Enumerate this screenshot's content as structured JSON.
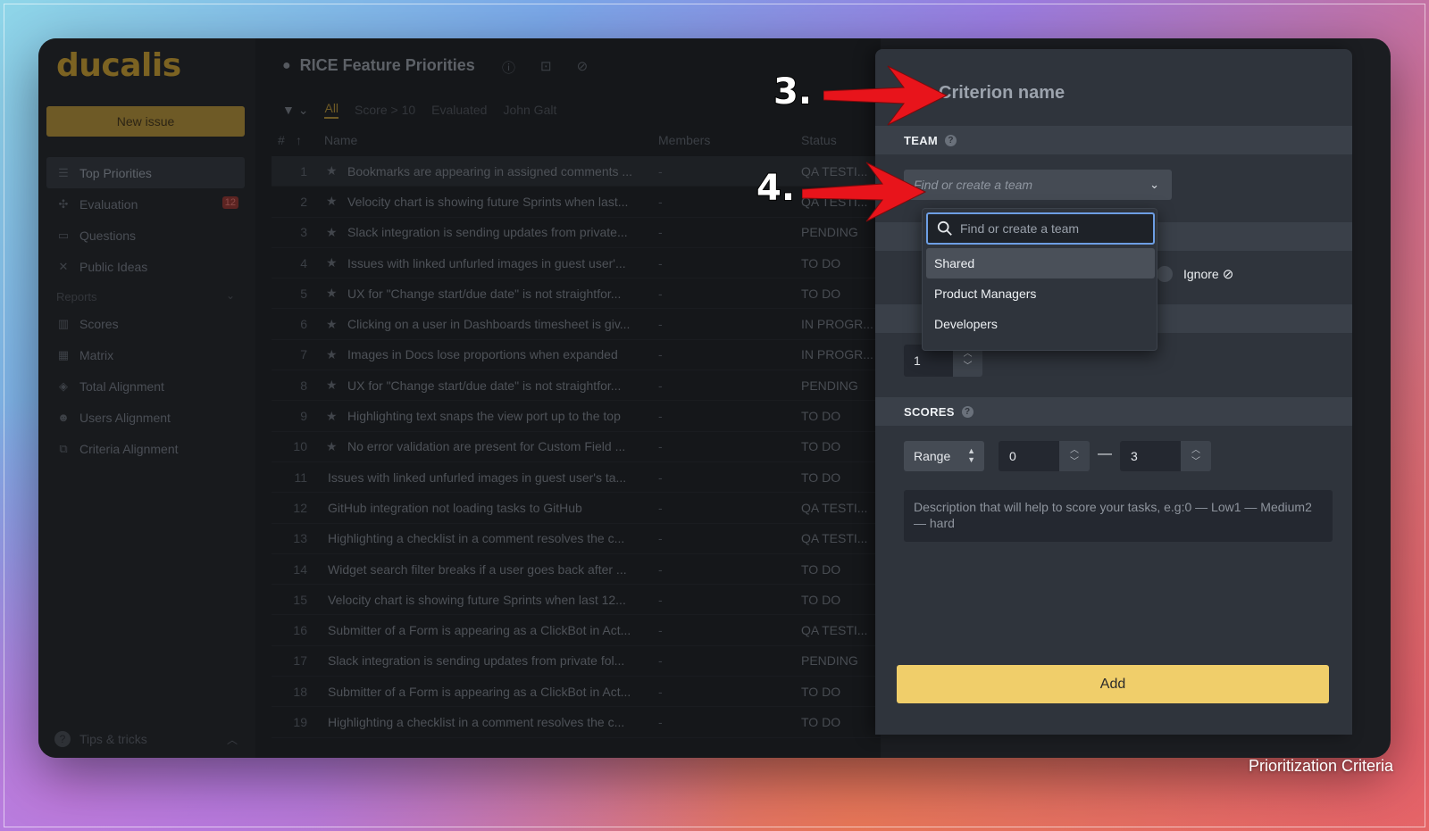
{
  "app": {
    "logo": "ducalis",
    "new_issue_label": "New issue",
    "badge_evaluation": "12",
    "tips_label": "Tips & tricks"
  },
  "sidebar": {
    "items": [
      {
        "label": "Top Priorities",
        "icon": "list-icon"
      },
      {
        "label": "Evaluation",
        "icon": "evaluation-icon"
      },
      {
        "label": "Questions",
        "icon": "questions-icon"
      },
      {
        "label": "Public Ideas",
        "icon": "public-ideas-icon"
      }
    ],
    "reports_label": "Reports",
    "report_items": [
      {
        "label": "Scores",
        "icon": "scores-icon"
      },
      {
        "label": "Matrix",
        "icon": "matrix-icon"
      },
      {
        "label": "Total Alignment",
        "icon": "layers-icon"
      },
      {
        "label": "Users Alignment",
        "icon": "users-icon"
      },
      {
        "label": "Criteria Alignment",
        "icon": "criteria-icon"
      }
    ]
  },
  "board": {
    "title": "RICE Feature Priorities",
    "filters": [
      "All",
      "Score > 10",
      "Evaluated",
      "John Galt"
    ],
    "columns": {
      "num": "#",
      "name": "Name",
      "members": "Members",
      "status": "Status"
    },
    "rows": [
      {
        "num": "1",
        "starred": true,
        "name": "Bookmarks are appearing in assigned comments ...",
        "members": "-",
        "status": "QA TESTI..."
      },
      {
        "num": "2",
        "starred": true,
        "name": "Velocity chart is showing future Sprints when last...",
        "members": "-",
        "status": "QA TESTI..."
      },
      {
        "num": "3",
        "starred": true,
        "name": "Slack integration is sending updates from private...",
        "members": "-",
        "status": "PENDING"
      },
      {
        "num": "4",
        "starred": true,
        "name": "Issues with linked unfurled images in guest user'...",
        "members": "-",
        "status": "TO DO"
      },
      {
        "num": "5",
        "starred": true,
        "name": "UX for \"Change start/due date\" is not straightfor...",
        "members": "-",
        "status": "TO DO"
      },
      {
        "num": "6",
        "starred": true,
        "name": "Clicking on a user in Dashboards timesheet is giv...",
        "members": "-",
        "status": "IN PROGR..."
      },
      {
        "num": "7",
        "starred": true,
        "name": "Images in Docs lose proportions when expanded",
        "members": "-",
        "status": "IN PROGR..."
      },
      {
        "num": "8",
        "starred": true,
        "name": "UX for \"Change start/due date\" is not straightfor...",
        "members": "-",
        "status": "PENDING"
      },
      {
        "num": "9",
        "starred": true,
        "name": "Highlighting text snaps the view port up to the top",
        "members": "-",
        "status": "TO DO"
      },
      {
        "num": "10",
        "starred": true,
        "name": "No error validation are present for Custom Field ...",
        "members": "-",
        "status": "TO DO"
      },
      {
        "num": "11",
        "starred": false,
        "name": "Issues with linked unfurled images in guest user's ta...",
        "members": "-",
        "status": "TO DO"
      },
      {
        "num": "12",
        "starred": false,
        "name": "GitHub integration not loading tasks to GitHub",
        "members": "-",
        "status": "QA TESTI..."
      },
      {
        "num": "13",
        "starred": false,
        "name": "Highlighting a checklist in a comment resolves the c...",
        "members": "-",
        "status": "QA TESTI..."
      },
      {
        "num": "14",
        "starred": false,
        "name": "Widget search filter breaks if a user goes back after ...",
        "members": "-",
        "status": "TO DO"
      },
      {
        "num": "15",
        "starred": false,
        "name": "Velocity chart is showing future Sprints when last 12...",
        "members": "-",
        "status": "TO DO"
      },
      {
        "num": "16",
        "starred": false,
        "name": "Submitter of a Form is appearing as a ClickBot in Act...",
        "members": "-",
        "status": "QA TESTI..."
      },
      {
        "num": "17",
        "starred": false,
        "name": "Slack integration is sending updates from private fol...",
        "members": "-",
        "status": "PENDING"
      },
      {
        "num": "18",
        "starred": false,
        "name": "Submitter of a Form is appearing as a ClickBot in Act...",
        "members": "-",
        "status": "TO DO"
      },
      {
        "num": "19",
        "starred": false,
        "name": "Highlighting a checklist in a comment resolves the c...",
        "members": "-",
        "status": "TO DO"
      }
    ]
  },
  "panel": {
    "title": "Criterion name",
    "team_label": "TEAM",
    "team_placeholder": "Find or create a team",
    "ignore_label": "Ignore",
    "weight_value": "1",
    "scores_label": "SCORES",
    "range_value": "Range",
    "range_min": "0",
    "range_dash": "—",
    "range_max": "3",
    "description_placeholder": "Description that will help to score your tasks, e.g:0 — Low1 — Medium2 — hard",
    "add_label": "Add"
  },
  "dropdown": {
    "search_placeholder": "Find or create a team",
    "options": [
      "Shared",
      "Product Managers",
      "Developers"
    ],
    "selected": "Shared"
  },
  "annotations": {
    "step3": "3.",
    "step4": "4.",
    "arrow_color": "#e8141b"
  },
  "caption": "Prioritization Criteria"
}
